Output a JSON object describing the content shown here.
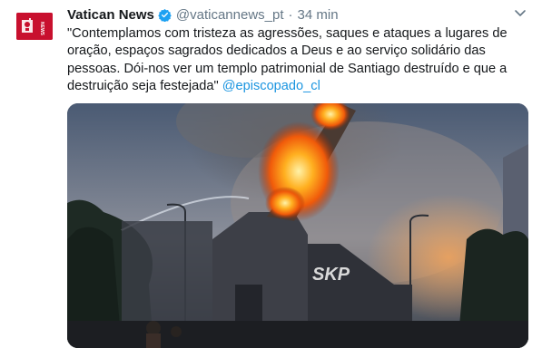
{
  "tweet": {
    "author_name": "Vatican News",
    "handle": "@vaticannews_pt",
    "separator": "·",
    "time": "34 min",
    "text": "\"Contemplamos com tristeza as agressões, saques e ataques a lugares de oração, espaços sagrados dedicados a Deus e ao serviço solidário das pessoas. Dói-nos ver um templo patrimonial de Santiago destruído e que a destruição seja festejada\" ",
    "mention": "@episcopado_cl",
    "avatar_text": "NEWS"
  },
  "colors": {
    "accent": "#1b95e0",
    "avatar_red": "#c8102e",
    "meta_gray": "#657786"
  },
  "icons": {
    "verified": "verified-badge-icon",
    "menu": "chevron-down-icon",
    "avatar": "vatican-news-logo"
  },
  "media": {
    "graffiti": "SKP"
  }
}
